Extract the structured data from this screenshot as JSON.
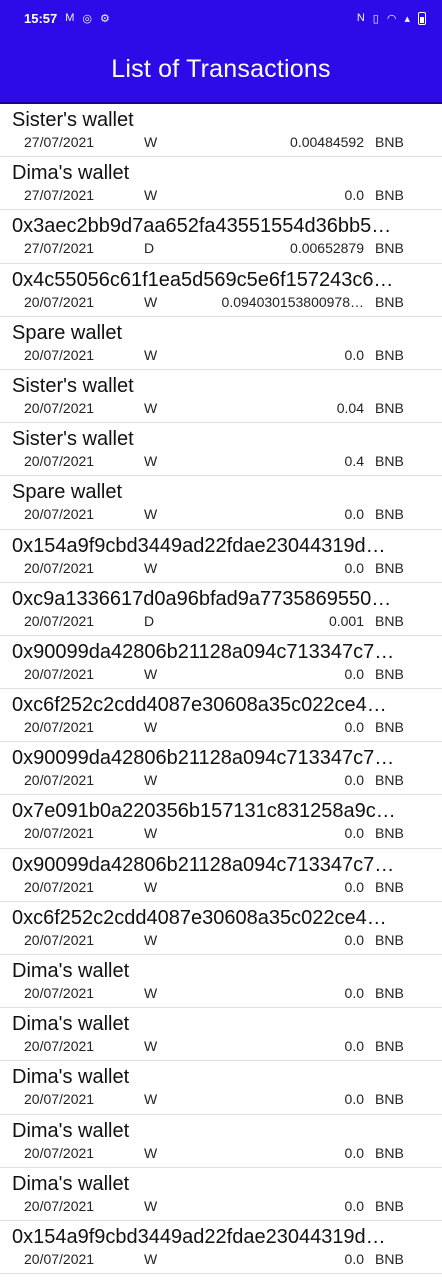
{
  "status_bar": {
    "time": "15:57",
    "left_icons": [
      "gmail-icon",
      "whatsapp-icon",
      "settings-icon"
    ],
    "right_icons": [
      "nfc-icon",
      "vibrate-icon",
      "wifi-icon",
      "signal-icon",
      "battery-icon"
    ]
  },
  "app_bar": {
    "title": "List of Transactions"
  },
  "colors": {
    "primary": "#2d0be8"
  },
  "transactions": [
    {
      "name": "Sister's wallet",
      "date": "27/07/2021",
      "type": "W",
      "amount": "0.00484592",
      "unit": "BNB"
    },
    {
      "name": "Dima's wallet",
      "date": "27/07/2021",
      "type": "W",
      "amount": "0.0",
      "unit": "BNB"
    },
    {
      "name": "0x3aec2bb9d7aa652fa43551554d36bb5…",
      "date": "27/07/2021",
      "type": "D",
      "amount": "0.00652879",
      "unit": "BNB"
    },
    {
      "name": "0x4c55056c61f1ea5d569c5e6f157243c6…",
      "date": "20/07/2021",
      "type": "W",
      "amount": "0.094030153800978…",
      "unit": "BNB"
    },
    {
      "name": "Spare wallet",
      "date": "20/07/2021",
      "type": "W",
      "amount": "0.0",
      "unit": "BNB"
    },
    {
      "name": "Sister's wallet",
      "date": "20/07/2021",
      "type": "W",
      "amount": "0.04",
      "unit": "BNB"
    },
    {
      "name": "Sister's wallet",
      "date": "20/07/2021",
      "type": "W",
      "amount": "0.4",
      "unit": "BNB"
    },
    {
      "name": "Spare wallet",
      "date": "20/07/2021",
      "type": "W",
      "amount": "0.0",
      "unit": "BNB"
    },
    {
      "name": "0x154a9f9cbd3449ad22fdae23044319d…",
      "date": "20/07/2021",
      "type": "W",
      "amount": "0.0",
      "unit": "BNB"
    },
    {
      "name": "0xc9a1336617d0a96bfad9a7735869550…",
      "date": "20/07/2021",
      "type": "D",
      "amount": "0.001",
      "unit": "BNB"
    },
    {
      "name": "0x90099da42806b21128a094c713347c7…",
      "date": "20/07/2021",
      "type": "W",
      "amount": "0.0",
      "unit": "BNB"
    },
    {
      "name": "0xc6f252c2cdd4087e30608a35c022ce4…",
      "date": "20/07/2021",
      "type": "W",
      "amount": "0.0",
      "unit": "BNB"
    },
    {
      "name": "0x90099da42806b21128a094c713347c7…",
      "date": "20/07/2021",
      "type": "W",
      "amount": "0.0",
      "unit": "BNB"
    },
    {
      "name": "0x7e091b0a220356b157131c831258a9c…",
      "date": "20/07/2021",
      "type": "W",
      "amount": "0.0",
      "unit": "BNB"
    },
    {
      "name": "0x90099da42806b21128a094c713347c7…",
      "date": "20/07/2021",
      "type": "W",
      "amount": "0.0",
      "unit": "BNB"
    },
    {
      "name": "0xc6f252c2cdd4087e30608a35c022ce4…",
      "date": "20/07/2021",
      "type": "W",
      "amount": "0.0",
      "unit": "BNB"
    },
    {
      "name": "Dima's wallet",
      "date": "20/07/2021",
      "type": "W",
      "amount": "0.0",
      "unit": "BNB"
    },
    {
      "name": "Dima's wallet",
      "date": "20/07/2021",
      "type": "W",
      "amount": "0.0",
      "unit": "BNB"
    },
    {
      "name": "Dima's wallet",
      "date": "20/07/2021",
      "type": "W",
      "amount": "0.0",
      "unit": "BNB"
    },
    {
      "name": "Dima's wallet",
      "date": "20/07/2021",
      "type": "W",
      "amount": "0.0",
      "unit": "BNB"
    },
    {
      "name": "Dima's wallet",
      "date": "20/07/2021",
      "type": "W",
      "amount": "0.0",
      "unit": "BNB"
    },
    {
      "name": "0x154a9f9cbd3449ad22fdae23044319d…",
      "date": "20/07/2021",
      "type": "W",
      "amount": "0.0",
      "unit": "BNB"
    }
  ]
}
